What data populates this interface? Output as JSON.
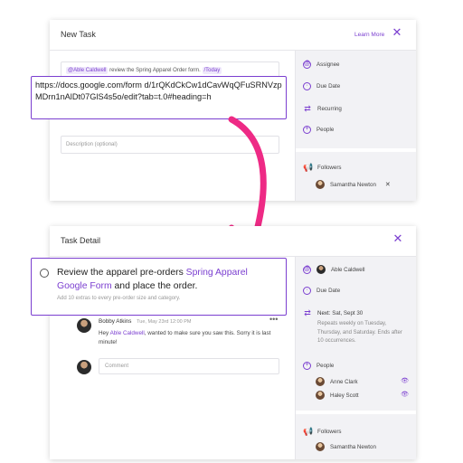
{
  "new_task": {
    "title": "New Task",
    "learn_more": "Learn More",
    "mention": "@Able Caldwell",
    "mention_text": "review the Spring Apparel Order form.",
    "due_tag": "/Today",
    "url_text": "https://docs.google.com/form d/1rQKdCkCw1dCavWqQFuSRNVzpMDrn1nAlDt07GlS4s5o/edit?tab=t.0#heading=h",
    "description_placeholder": "Description (optional)",
    "sidebar": {
      "assignee": "Assignee",
      "due_date": "Due Date",
      "recurring": "Recurring",
      "people": "People",
      "followers": "Followers",
      "follower_name": "Samantha Newton"
    }
  },
  "task_detail": {
    "title": "Task Detail",
    "task_text_before": "Review the apparel pre-orders ",
    "task_link": "Spring Apparel Google Form",
    "task_text_after": " and place the order.",
    "task_subtext": "Add 10 extras to every pre-order size and category.",
    "comment": {
      "author": "Bobby Atkins",
      "time": "Tue, May 23rd 12:00 PM",
      "mention": "Able Caldwell",
      "text_before": "Hey ",
      "text_after": ", wanted to make sure you saw this. Sorry it is last minute!"
    },
    "comment_placeholder": "Comment",
    "sidebar": {
      "assignee_name": "Able Caldwell",
      "due_date": "Due Date",
      "next_label": "Next:",
      "next_date": "Sat, Sept 30",
      "recurrence_text": "Repeats weekly on Tuesday, Thursday, and Saturday. Ends after 10 occurrences.",
      "people": "People",
      "person_1": "Anne Clark",
      "person_2": "Haley Scott",
      "followers": "Followers",
      "follower_name": "Samantha Newton"
    }
  },
  "colors": {
    "accent": "#7b3fd0",
    "arrow": "#ee2a85"
  }
}
